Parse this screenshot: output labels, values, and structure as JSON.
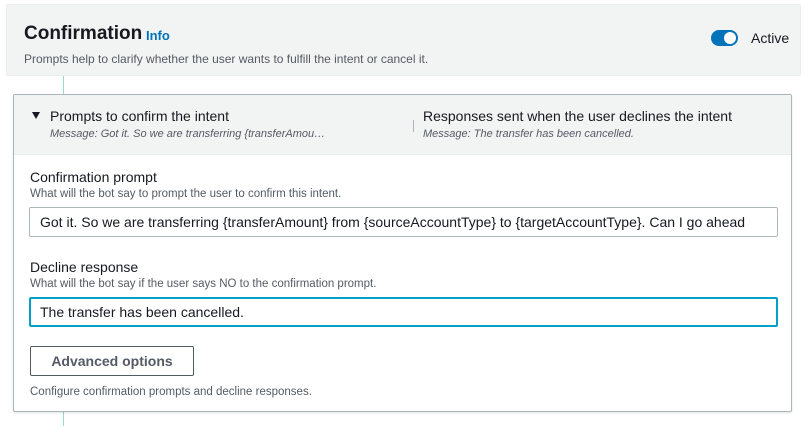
{
  "header": {
    "title": "Confirmation",
    "info_link": "Info",
    "subtitle": "Prompts help to clarify whether the user wants to fulfill the intent or cancel it.",
    "toggle": {
      "label": "Active",
      "on": true
    }
  },
  "panel": {
    "expanded": true,
    "columns": [
      {
        "title": "Prompts to confirm the intent",
        "message": "Message: Got it. So we are transferring {transferAmou…"
      },
      {
        "title": "Responses sent when the user declines the intent",
        "message": "Message: The transfer has been cancelled."
      }
    ],
    "confirmation_prompt": {
      "label": "Confirmation prompt",
      "description": "What will the bot say to prompt the user to confirm this intent.",
      "value": "Got it. So we are transferring {transferAmount} from {sourceAccountType} to {targetAccountType}. Can I go ahead"
    },
    "decline_response": {
      "label": "Decline response",
      "description": "What will the bot say if the user says NO to the confirmation prompt.",
      "value": "The transfer has been cancelled."
    },
    "advanced_button": "Advanced options",
    "footer_note": "Configure confirmation prompts and decline responses."
  },
  "colors": {
    "accent": "#0073bb",
    "focus": "#00a1c9",
    "header_bg": "#f2f3f3",
    "connector": "#9bd9c8"
  }
}
